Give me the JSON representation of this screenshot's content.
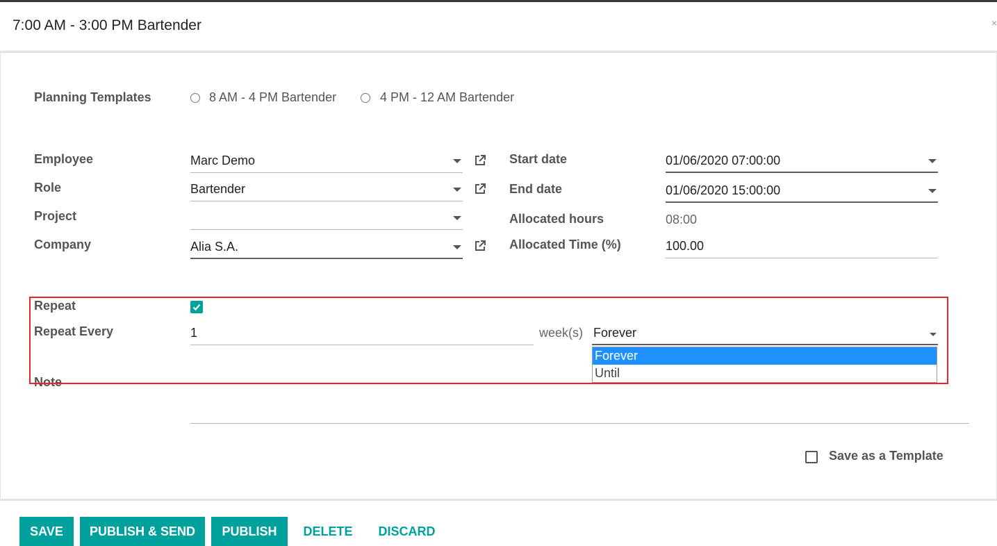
{
  "dialog": {
    "title": "7:00 AM - 3:00 PM Bartender",
    "close_glyph": "×"
  },
  "templates": {
    "label": "Planning Templates",
    "options": [
      "8 AM - 4 PM Bartender",
      "4 PM - 12 AM Bartender"
    ]
  },
  "left_fields": {
    "employee": {
      "label": "Employee",
      "value": "Marc Demo"
    },
    "role": {
      "label": "Role",
      "value": "Bartender"
    },
    "project": {
      "label": "Project",
      "value": ""
    },
    "company": {
      "label": "Company",
      "value": "Alia S.A."
    }
  },
  "right_fields": {
    "start_date": {
      "label": "Start date",
      "value": "01/06/2020 07:00:00"
    },
    "end_date": {
      "label": "End date",
      "value": "01/06/2020 15:00:00"
    },
    "allocated_hours": {
      "label": "Allocated hours",
      "value": "08:00"
    },
    "allocated_time": {
      "label": "Allocated Time (%)",
      "value": "100.00"
    }
  },
  "repeat": {
    "label": "Repeat",
    "checked": true,
    "every_label": "Repeat Every",
    "every_value": "1",
    "unit": "week(s)",
    "type_value": "Forever",
    "type_options": [
      "Forever",
      "Until"
    ]
  },
  "note": {
    "label": "Note",
    "value": ""
  },
  "save_template": {
    "label": "Save as a Template",
    "checked": false
  },
  "buttons": {
    "save": "SAVE",
    "publish_send": "PUBLISH & SEND",
    "publish": "PUBLISH",
    "delete": "DELETE",
    "discard": "DISCARD"
  },
  "colors": {
    "accent": "#00a09d",
    "selection": "#1e90ff",
    "highlight": "#e5272e"
  },
  "icons": [
    "external-link-icon",
    "caret-down-icon",
    "check-icon",
    "radio-icon",
    "close-icon"
  ]
}
